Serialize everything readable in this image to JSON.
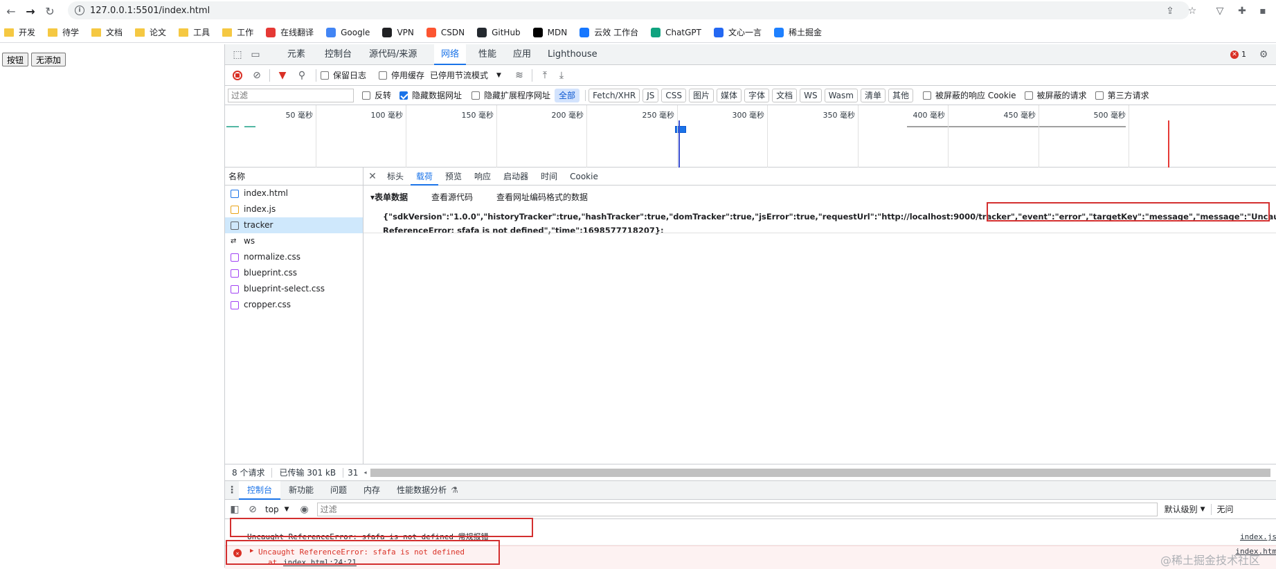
{
  "browser": {
    "url": "127.0.0.1:5501/index.html",
    "bookmarks": [
      {
        "label": "开发",
        "icon": "folder-icon"
      },
      {
        "label": "待学",
        "icon": "folder-icon"
      },
      {
        "label": "文档",
        "icon": "folder-icon"
      },
      {
        "label": "论文",
        "icon": "folder-icon"
      },
      {
        "label": "工具",
        "icon": "folder-icon"
      },
      {
        "label": "工作",
        "icon": "folder-icon"
      },
      {
        "label": "在线翻译",
        "icon": "youdao-icon"
      },
      {
        "label": "Google",
        "icon": "google-icon"
      },
      {
        "label": "VPN",
        "icon": "globe-icon"
      },
      {
        "label": "CSDN",
        "icon": "csdn-icon"
      },
      {
        "label": "GitHub",
        "icon": "github-icon"
      },
      {
        "label": "MDN",
        "icon": "mdn-icon"
      },
      {
        "label": "云效 工作台",
        "icon": "yunxiao-icon"
      },
      {
        "label": "ChatGPT",
        "icon": "chatgpt-icon"
      },
      {
        "label": "文心一言",
        "icon": "wenxin-icon"
      },
      {
        "label": "稀土掘金",
        "icon": "juejin-icon"
      }
    ]
  },
  "page": {
    "button1": "按钮",
    "button2": "无添加"
  },
  "devtools": {
    "tabs": [
      "元素",
      "控制台",
      "源代码/来源",
      "网络",
      "性能",
      "应用",
      "Lighthouse"
    ],
    "active_tab": "网络",
    "error_count": "1",
    "network_toolbar": {
      "preserve_log": "保留日志",
      "disable_cache": "停用缓存",
      "throttle": "已停用节流模式"
    },
    "filter": {
      "placeholder": "过滤",
      "invert": "反转",
      "hide_data_urls": "隐藏数据网址",
      "hide_ext_urls": "隐藏扩展程序网址",
      "types": [
        "全部",
        "Fetch/XHR",
        "JS",
        "CSS",
        "图片",
        "媒体",
        "字体",
        "文档",
        "WS",
        "Wasm",
        "清单",
        "其他"
      ],
      "blocked_cookies": "被屏蔽的响应 Cookie",
      "blocked_requests": "被屏蔽的请求",
      "third_party": "第三方请求"
    },
    "timeline_labels": [
      "50 毫秒",
      "100 毫秒",
      "150 毫秒",
      "200 毫秒",
      "250 毫秒",
      "300 毫秒",
      "350 毫秒",
      "400 毫秒",
      "450 毫秒",
      "500 毫秒"
    ],
    "requests_header": "名称",
    "requests": [
      {
        "name": "index.html",
        "type": "doc"
      },
      {
        "name": "index.js",
        "type": "script"
      },
      {
        "name": "tracker",
        "type": "other",
        "selected": true
      },
      {
        "name": "ws",
        "type": "ws"
      },
      {
        "name": "normalize.css",
        "type": "css"
      },
      {
        "name": "blueprint.css",
        "type": "css"
      },
      {
        "name": "blueprint-select.css",
        "type": "css"
      },
      {
        "name": "cropper.css",
        "type": "css"
      }
    ],
    "detail_tabs": [
      "标头",
      "载荷",
      "预览",
      "响应",
      "启动器",
      "时间",
      "Cookie"
    ],
    "active_detail_tab": "载荷",
    "payload": {
      "section": "▾表单数据",
      "view_source": "查看源代码",
      "view_url_encoded": "查看网址编码格式的数据",
      "line1_a": "{\"sdkVersion\":\"1.0.0\",\"historyTracker\":true,\"hashTracker\":true,\"domTracker\":true,\"jsError\":true,\"requestUrl\":\"http://localhost:9000/tracker\",",
      "line1_b": "\"event\":\"error\",\"targetKey\":\"message\",\"message\":\"Uncaught",
      "line2": "ReferenceError: sfafa is not defined\",\"time\":1698577718207}:"
    },
    "status": {
      "requests": "8 个请求",
      "transferred": "已传输 301 kB",
      "extra": "31"
    },
    "drawer": {
      "tabs": [
        "控制台",
        "新功能",
        "问题",
        "内存",
        "性能数据分析"
      ],
      "active": "控制台",
      "context": "top",
      "filter_placeholder": "过滤",
      "levels": "默认级别",
      "no_issues": "无问",
      "log_message": "Uncaught ReferenceError: sfafa is not defined 常规报错",
      "log_source": "index.js",
      "error_message": "Uncaught ReferenceError: sfafa is not defined",
      "error_at": "at",
      "error_link": "index.html:24:21",
      "error_source": "index.htm"
    }
  },
  "watermark": "@稀土掘金技术社区"
}
